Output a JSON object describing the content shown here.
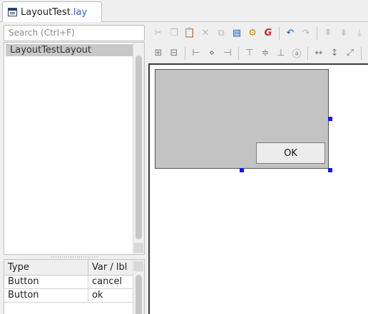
{
  "tabs": [
    {
      "name": "LayoutTest",
      "extension": ".lay",
      "icon": "layout-file-icon"
    }
  ],
  "left_pane": {
    "search": {
      "placeholder": "Search (Ctrl+F)",
      "value": ""
    },
    "tree": {
      "items": [
        {
          "label": "LayoutTestLayout",
          "selected": true
        }
      ]
    },
    "table": {
      "columns": [
        "Type",
        "Var / lbl"
      ],
      "rows": [
        {
          "type": "Button",
          "var": "cancel"
        },
        {
          "type": "Button",
          "var": "ok"
        }
      ]
    }
  },
  "toolbar_row_1": [
    {
      "icon": "cut-icon",
      "glyph": "✂",
      "enabled": false
    },
    {
      "icon": "copy-icon",
      "glyph": "❐",
      "enabled": false
    },
    {
      "icon": "paste-icon",
      "glyph": "📋",
      "enabled": true
    },
    {
      "icon": "delete-icon",
      "glyph": "✕",
      "enabled": false
    },
    {
      "icon": "replace-icon",
      "glyph": "⧉",
      "enabled": false
    },
    {
      "icon": "page-icon",
      "glyph": "▤",
      "enabled": true
    },
    {
      "icon": "properties-icon",
      "glyph": "⚙",
      "enabled": true
    },
    {
      "icon": "generate-code-icon",
      "glyph": "G",
      "enabled": true
    },
    {
      "icon": "undo-icon",
      "glyph": "↶",
      "enabled": true
    },
    {
      "icon": "redo-icon",
      "glyph": "↷",
      "enabled": false
    },
    {
      "icon": "move-up-icon",
      "glyph": "⇞",
      "enabled": false
    },
    {
      "icon": "move-down-icon",
      "glyph": "⇟",
      "enabled": false
    },
    {
      "icon": "move-last-icon",
      "glyph": "⤓",
      "enabled": false
    }
  ],
  "toolbar_row_2": [
    {
      "icon": "align-hcenter-frame-icon",
      "glyph": "⊞"
    },
    {
      "icon": "align-vcenter-frame-icon",
      "glyph": "⊟"
    },
    {
      "icon": "align-left-icon",
      "glyph": "⊢"
    },
    {
      "icon": "align-hcenter-icon",
      "glyph": "⋄"
    },
    {
      "icon": "align-right-icon",
      "glyph": "⊣"
    },
    {
      "icon": "align-top-icon",
      "glyph": "⊤"
    },
    {
      "icon": "align-vcenter-icon",
      "glyph": "≑"
    },
    {
      "icon": "align-bottom-icon",
      "glyph": "⊥"
    },
    {
      "icon": "align-baseline-icon",
      "glyph": "ⓐ"
    },
    {
      "icon": "same-width-icon",
      "glyph": "↔"
    },
    {
      "icon": "same-height-icon",
      "glyph": "↕"
    },
    {
      "icon": "same-size-icon",
      "glyph": "⤢"
    },
    {
      "icon": "distribute-icon",
      "glyph": "⇹"
    }
  ],
  "canvas": {
    "button_label": "OK",
    "colors": {
      "panel": "#c3c3c3",
      "selection_handle": "#1a1ae6",
      "canvas": "#ffffff"
    }
  }
}
